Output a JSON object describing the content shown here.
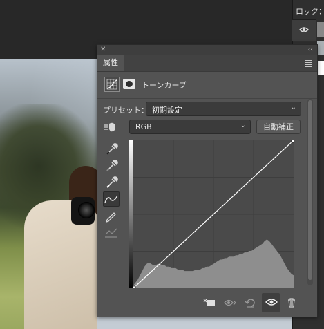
{
  "window": {
    "layers_label": "ロック：",
    "panel_tab": "属性",
    "adjustment_name": "トーンカーブ"
  },
  "preset": {
    "label": "プリセット：",
    "value": "初期設定"
  },
  "channel": {
    "value": "RGB"
  },
  "buttons": {
    "auto_label": "自動補正"
  },
  "chart_data": {
    "type": "line",
    "title": "",
    "xlim": [
      0,
      255
    ],
    "ylim": [
      0,
      255
    ],
    "grid": true,
    "curve_points": [
      [
        0,
        0
      ],
      [
        255,
        255
      ]
    ],
    "histogram": [
      2,
      4,
      6,
      9,
      12,
      15,
      17,
      18,
      17,
      16,
      16,
      17,
      17,
      16,
      16,
      15,
      15,
      14,
      14,
      14,
      13,
      13,
      13,
      12,
      12,
      12,
      12,
      12,
      13,
      13,
      13,
      14,
      14,
      15,
      15,
      16,
      17,
      18,
      19,
      20,
      20,
      21,
      21,
      22,
      22,
      22,
      23,
      23,
      24,
      24,
      25,
      25,
      26,
      26,
      27,
      28,
      29,
      30,
      31,
      33,
      34,
      33,
      31,
      29,
      27,
      25,
      23,
      20,
      17,
      14,
      12,
      10,
      9
    ]
  },
  "colors": {
    "panel_bg": "#535353",
    "graph_bg": "#4a4a4a",
    "histogram": "#8e8e8e",
    "curve": "#ffffff"
  }
}
